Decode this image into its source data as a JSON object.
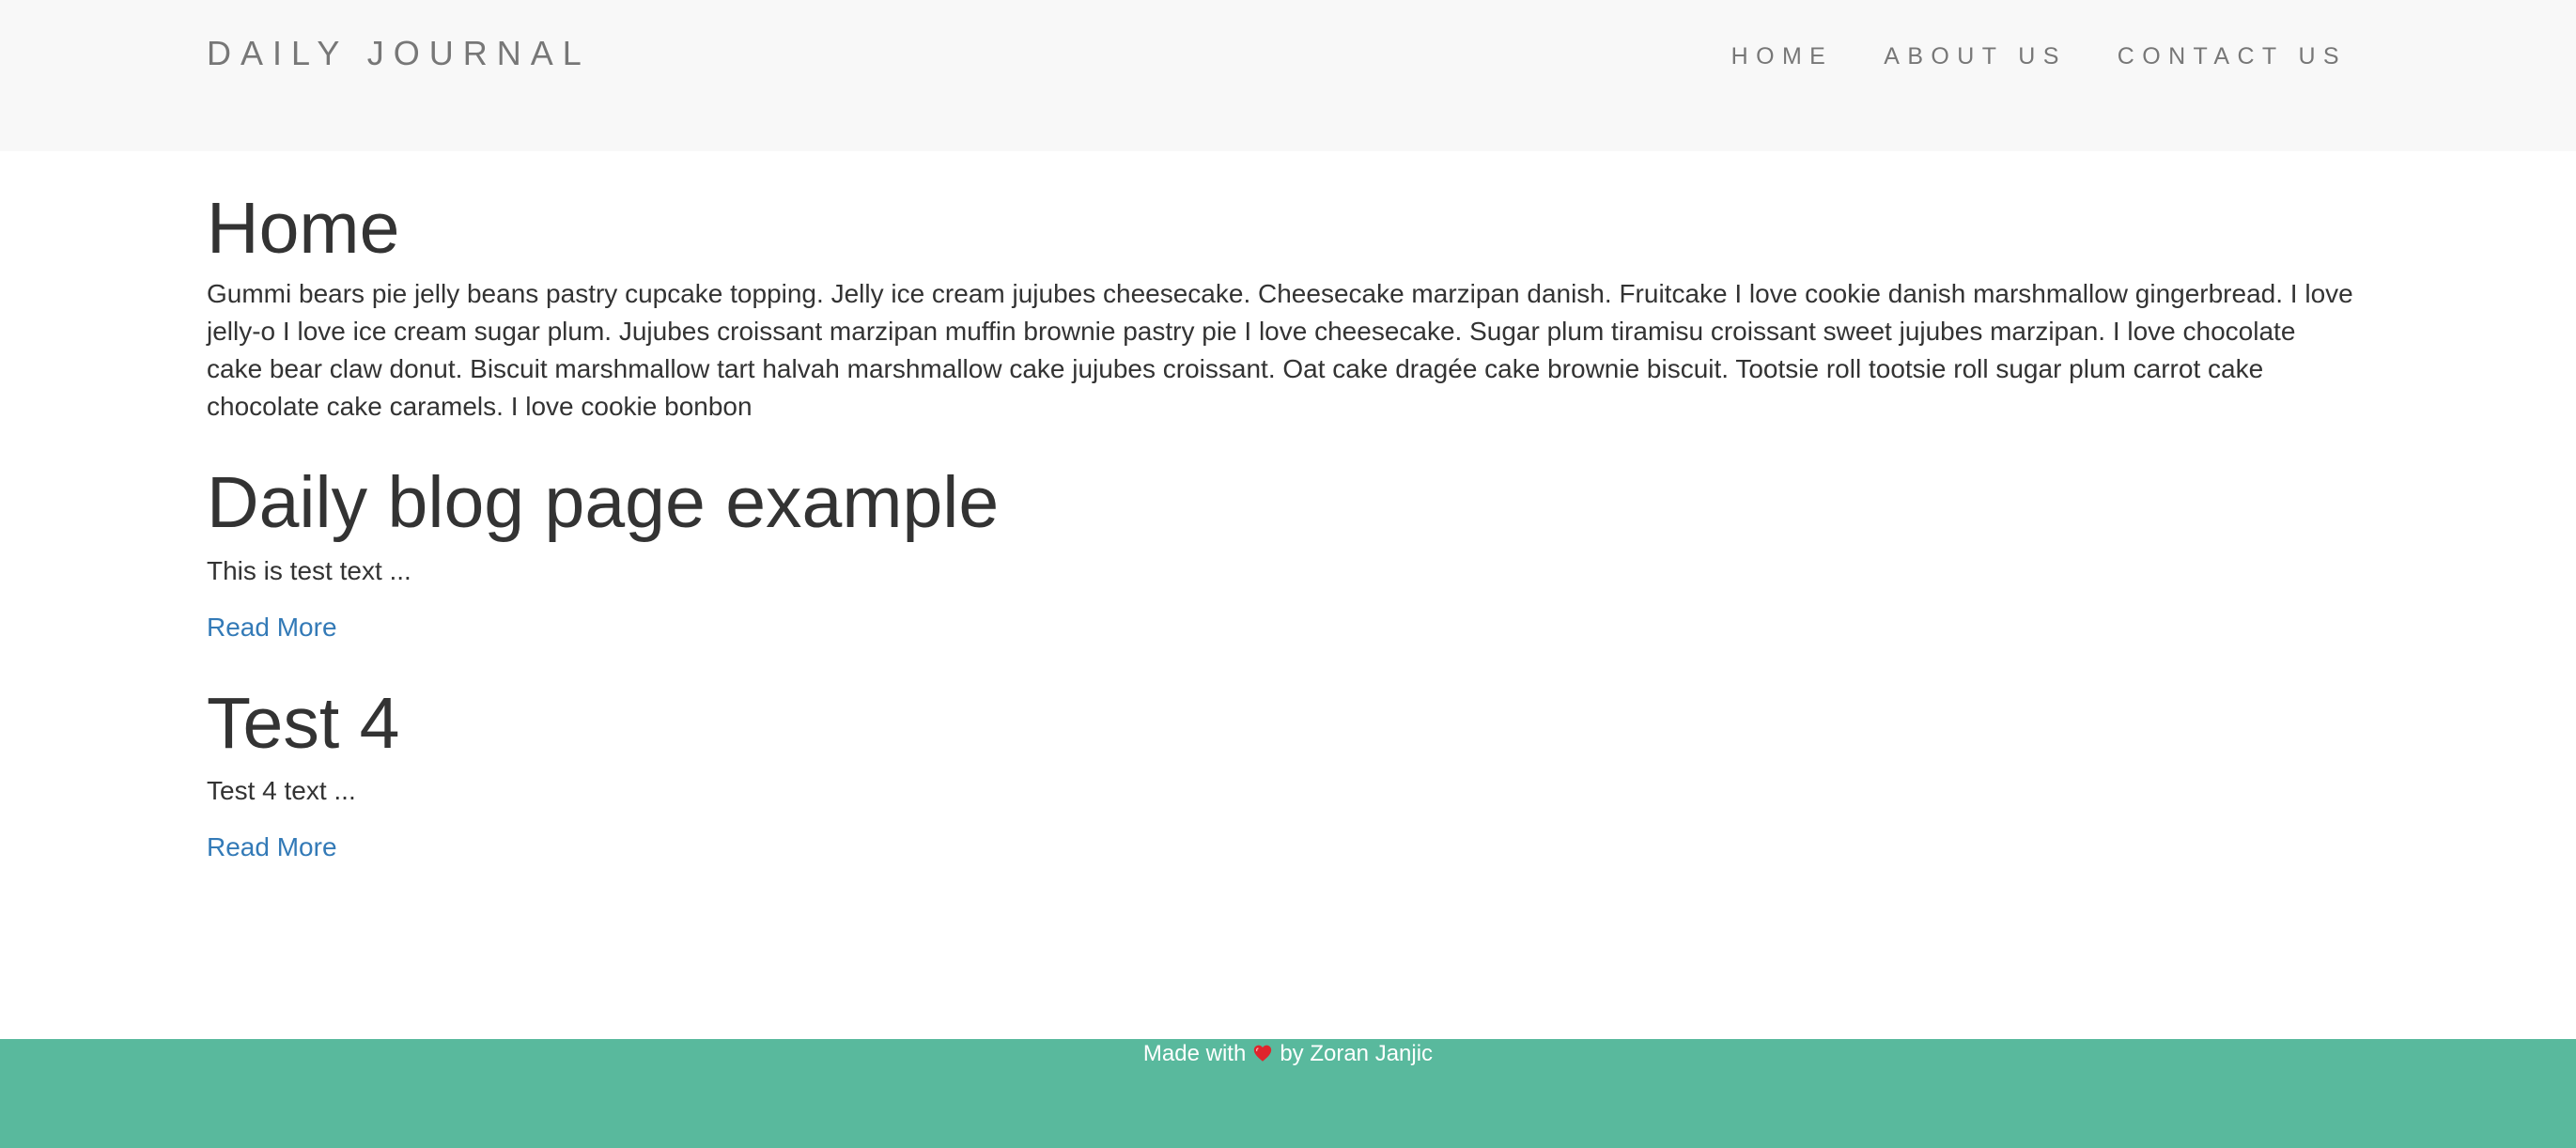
{
  "navbar": {
    "brand": "DAILY JOURNAL",
    "links": [
      {
        "label": "HOME"
      },
      {
        "label": "ABOUT US"
      },
      {
        "label": "CONTACT US"
      }
    ]
  },
  "main": {
    "title": "Home",
    "intro": "Gummi bears pie jelly beans pastry cupcake topping. Jelly ice cream jujubes cheesecake. Cheesecake marzipan danish. Fruitcake I love cookie danish marshmallow gingerbread. I love jelly-o I love ice cream sugar plum. Jujubes croissant marzipan muffin brownie pastry pie I love cheesecake. Sugar plum tiramisu croissant sweet jujubes marzipan. I love chocolate cake bear claw donut. Biscuit marshmallow tart halvah marshmallow cake jujubes croissant. Oat cake dragée cake brownie biscuit. Tootsie roll tootsie roll sugar plum carrot cake chocolate cake caramels. I love cookie bonbon",
    "posts": [
      {
        "title": "Daily blog page example",
        "excerpt": "This is test text ...",
        "read_more": "Read More"
      },
      {
        "title": "Test 4",
        "excerpt": "Test 4 text ...",
        "read_more": "Read More"
      }
    ]
  },
  "footer": {
    "prefix": "Made with",
    "icon": "heart-icon",
    "suffix": "by Zoran Janjic"
  },
  "colors": {
    "navbar_bg": "#f8f8f8",
    "footer_bg": "#59b99d",
    "link": "#337ab7",
    "heart": "#e0242c"
  }
}
